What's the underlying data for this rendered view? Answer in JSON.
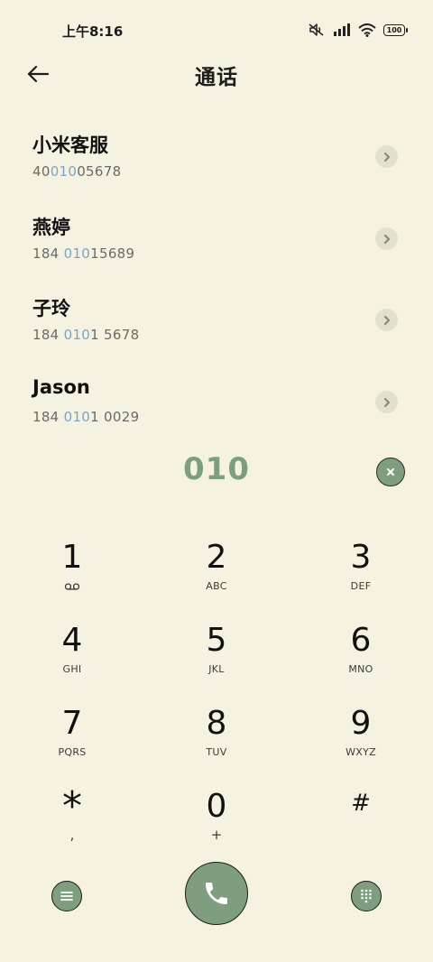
{
  "status_bar": {
    "time": "上午8:16",
    "battery": "100"
  },
  "header": {
    "title": "通话"
  },
  "contacts": [
    {
      "name": "小米客服",
      "num_pre": "40",
      "num_hl": "010",
      "num_post": "05678"
    },
    {
      "name": "燕婷",
      "num_pre": "184 ",
      "num_hl": "010",
      "num_post": "15689"
    },
    {
      "name": "子玲",
      "num_pre": "184 ",
      "num_hl": "010",
      "num_post": "1 5678"
    },
    {
      "name": "Jason",
      "num_pre": "184 ",
      "num_hl": "010",
      "num_post": "1 0029"
    }
  ],
  "dialer": {
    "input": "010"
  },
  "keypad": [
    {
      "digit": "1",
      "letters": ""
    },
    {
      "digit": "2",
      "letters": "ABC"
    },
    {
      "digit": "3",
      "letters": "DEF"
    },
    {
      "digit": "4",
      "letters": "GHI"
    },
    {
      "digit": "5",
      "letters": "JKL"
    },
    {
      "digit": "6",
      "letters": "MNO"
    },
    {
      "digit": "7",
      "letters": "PQRS"
    },
    {
      "digit": "8",
      "letters": "TUV"
    },
    {
      "digit": "9",
      "letters": "WXYZ"
    },
    {
      "digit": "*",
      "letters": ","
    },
    {
      "digit": "0",
      "letters": "+"
    },
    {
      "digit": "#",
      "letters": ""
    }
  ],
  "colors": {
    "background": "#F6F2E1",
    "accent_green": "#7E9E7F",
    "highlight_blue": "#7CA3C9"
  },
  "icons": {
    "back": "arrow-left-icon",
    "contact_detail": "chevron-right-icon",
    "clear": "close-icon",
    "menu": "menu-icon",
    "call": "phone-icon",
    "dialpad": "dialpad-icon",
    "voicemail": "voicemail-icon"
  }
}
